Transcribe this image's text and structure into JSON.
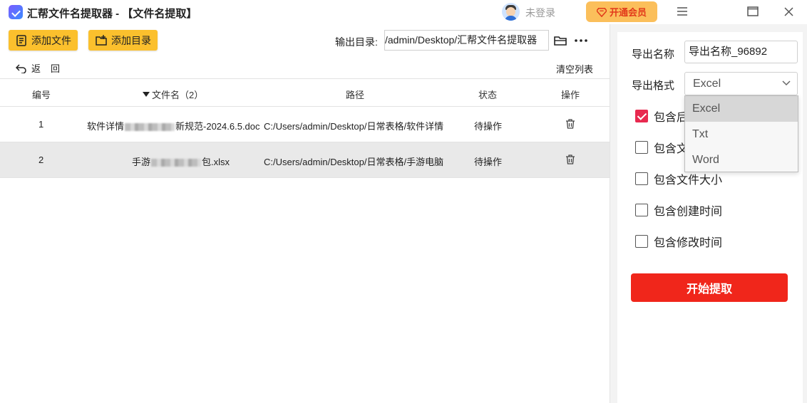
{
  "titlebar": {
    "title": "汇帮文件名提取器 - 【文件名提取】",
    "user_status": "未登录",
    "vip_label": "开通会员"
  },
  "toolbar": {
    "add_file_label": "添加文件",
    "add_dir_label": "添加目录",
    "output_label": "输出目录:",
    "output_path": "/admin/Desktop/汇帮文件名提取器",
    "back_label": "返回",
    "clear_label": "清空列表"
  },
  "table": {
    "headers": {
      "index": "编号",
      "filename": "文件名（2）",
      "path": "路径",
      "status": "状态",
      "action": "操作"
    },
    "rows": [
      {
        "index": "1",
        "name_prefix": "软件详情",
        "name_suffix": "新规范-2024.6.5.doc",
        "path": "C:/Users/admin/Desktop/日常表格/软件详情",
        "status": "待操作"
      },
      {
        "index": "2",
        "name_prefix": "手游",
        "name_suffix": "包.xlsx",
        "path": "C:/Users/admin/Desktop/日常表格/手游电脑",
        "status": "待操作"
      }
    ]
  },
  "export": {
    "name_label": "导出名称",
    "name_value": "导出名称_96892",
    "format_label": "导出格式",
    "format_value": "Excel",
    "format_options": [
      "Excel",
      "Txt",
      "Word"
    ],
    "checkboxes": [
      {
        "label": "包含后",
        "checked": true
      },
      {
        "label": "包含文",
        "checked": false
      },
      {
        "label": "包含文件大小",
        "checked": false
      },
      {
        "label": "包含创建时间",
        "checked": false
      },
      {
        "label": "包含修改时间",
        "checked": false
      }
    ],
    "start_label": "开始提取"
  },
  "colors": {
    "accent_yellow": "#fbc02d",
    "start_red": "#f0261b",
    "checkbox_red": "#e8294f",
    "vip_bg": "#fbbf5b"
  }
}
